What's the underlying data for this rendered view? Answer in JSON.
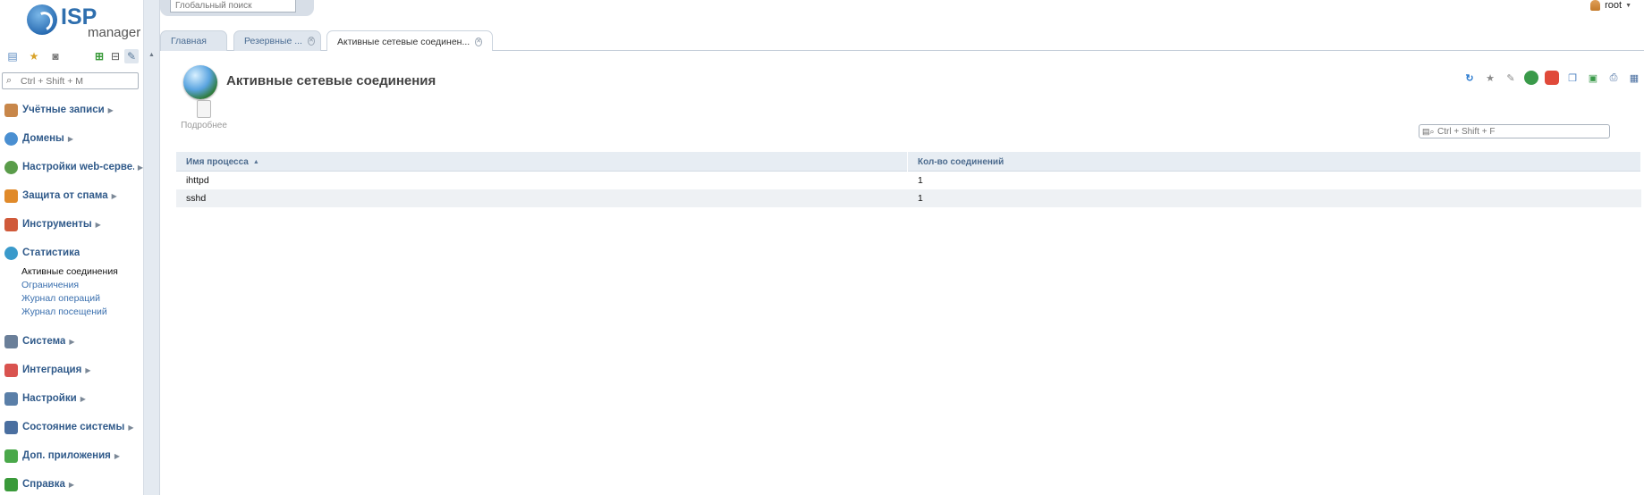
{
  "app": {
    "logo_line1": "ISP",
    "logo_line2": "manager"
  },
  "sidebar": {
    "search_placeholder": "Ctrl + Shift + M",
    "tools": [
      "tree-view-icon",
      "favorites-star-icon",
      "camera-icon",
      "expand-all-icon",
      "collapse-all-icon",
      "pin-icon"
    ],
    "groups": [
      {
        "label": "Учётные записи",
        "icon": "users-icon",
        "color": "#c8874a"
      },
      {
        "label": "Домены",
        "icon": "globe-icon",
        "color": "#4a8fd1"
      },
      {
        "label": "Настройки web-серве...",
        "icon": "web-settings-icon",
        "color": "#5a9c4a"
      },
      {
        "label": "Защита от спама",
        "icon": "shield-icon",
        "color": "#e08a2a"
      },
      {
        "label": "Инструменты",
        "icon": "tools-icon",
        "color": "#d05a3a"
      },
      {
        "label": "Статистика",
        "icon": "statistics-icon",
        "color": "#3a9acb"
      },
      {
        "label": "Система",
        "icon": "system-icon",
        "color": "#6a7f99"
      },
      {
        "label": "Интеграция",
        "icon": "integration-icon",
        "color": "#d9534f"
      },
      {
        "label": "Настройки",
        "icon": "settings-icon",
        "color": "#5a7fa8"
      },
      {
        "label": "Состояние системы",
        "icon": "monitor-icon",
        "color": "#4a6fa0"
      },
      {
        "label": "Доп. приложения",
        "icon": "plus-icon",
        "color": "#4aa84a"
      },
      {
        "label": "Справка",
        "icon": "help-icon",
        "color": "#3a9a3a"
      }
    ],
    "stat_items": [
      "Активные соединения",
      "Ограничения",
      "Журнал операций",
      "Журнал посещений"
    ]
  },
  "topbar": {
    "global_search_placeholder": "Глобальный поиск",
    "user": "root"
  },
  "tabs": [
    {
      "label": "Главная"
    },
    {
      "label": "Резервные ..."
    },
    {
      "label": "Активные сетевые соединен..."
    }
  ],
  "page": {
    "title": "Активные сетевые соединения",
    "more_label": "Подробнее",
    "filter_placeholder": "Ctrl + Shift + F",
    "actions": [
      {
        "icon": "refresh-icon",
        "color": "#2a7bd0"
      },
      {
        "icon": "star-icon",
        "color": "#8a8a8a"
      },
      {
        "icon": "pin-icon",
        "color": "#8a8a8a"
      },
      {
        "icon": "globe-icon",
        "color": "#3a9a4a"
      },
      {
        "icon": "database-icon",
        "color": "#e04a3a"
      },
      {
        "icon": "copy-icon",
        "color": "#4a7fc0"
      },
      {
        "icon": "export-icon",
        "color": "#3a9a4a"
      },
      {
        "icon": "print-icon",
        "color": "#4a6fa0"
      },
      {
        "icon": "table-settings-icon",
        "color": "#4a6fa0"
      }
    ]
  },
  "grid": {
    "columns": [
      "Имя процесса",
      "Кол-во соединений"
    ],
    "rows": [
      [
        "ihttpd",
        "1"
      ],
      [
        "sshd",
        "1"
      ]
    ]
  }
}
